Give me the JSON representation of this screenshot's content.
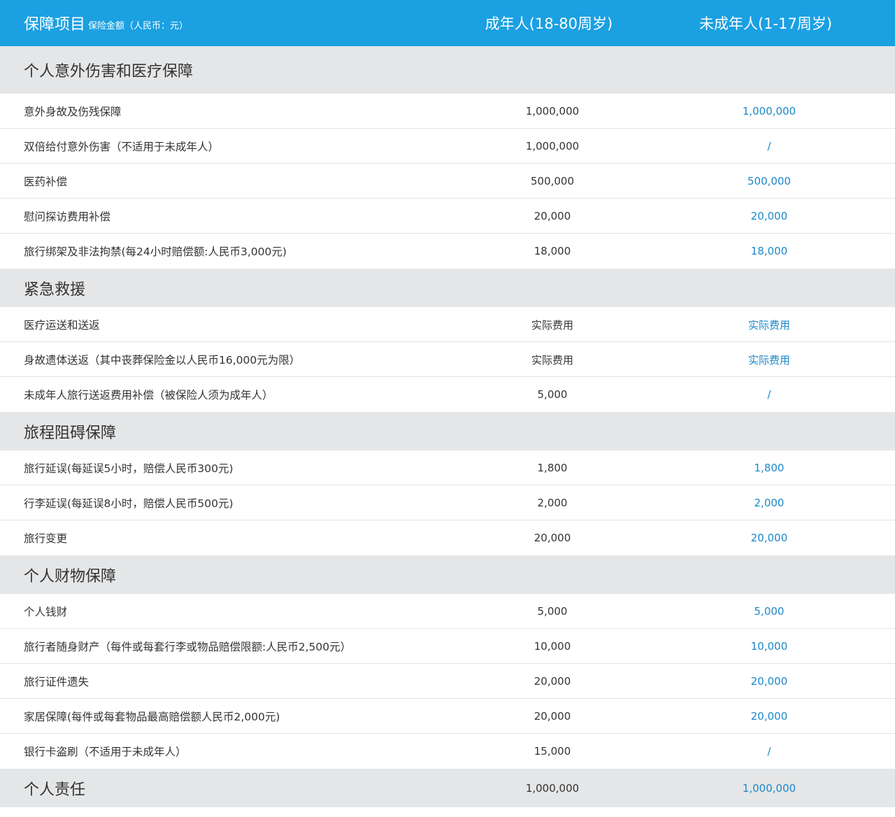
{
  "header": {
    "title": "保障项目",
    "subtitle": "保险金额（人民币：元）",
    "adult_col": "成年人(18-80周岁)",
    "minor_col": "未成年人(1-17周岁)"
  },
  "sections": [
    {
      "name": "个人意外伤害和医疗保障",
      "rows": [
        {
          "label": "意外身故及伤残保障",
          "adult": "1,000,000",
          "minor": "1,000,000"
        },
        {
          "label": "双倍给付意外伤害（不适用于未成年人）",
          "adult": "1,000,000",
          "minor": "/"
        },
        {
          "label": "医药补偿",
          "adult": "500,000",
          "minor": "500,000"
        },
        {
          "label": "慰问探访费用补偿",
          "adult": "20,000",
          "minor": "20,000"
        },
        {
          "label": "旅行绑架及非法拘禁(每24小时赔偿额:人民币3,000元)",
          "adult": "18,000",
          "minor": "18,000"
        }
      ]
    },
    {
      "name": "紧急救援",
      "rows": [
        {
          "label": "医疗运送和送返",
          "adult": "实际费用",
          "minor": "实际费用"
        },
        {
          "label": "身故遗体送返（其中丧葬保险金以人民币16,000元为限）",
          "adult": "实际费用",
          "minor": "实际费用"
        },
        {
          "label": "未成年人旅行送返费用补偿（被保险人须为成年人）",
          "adult": "5,000",
          "minor": "/"
        }
      ]
    },
    {
      "name": "旅程阻碍保障",
      "rows": [
        {
          "label": "旅行延误(每延误5小时，赔偿人民币300元)",
          "adult": "1,800",
          "minor": "1,800"
        },
        {
          "label": "行李延误(每延误8小时，赔偿人民币500元)",
          "adult": "2,000",
          "minor": "2,000"
        },
        {
          "label": "旅行变更",
          "adult": "20,000",
          "minor": "20,000"
        }
      ]
    },
    {
      "name": "个人财物保障",
      "rows": [
        {
          "label": "个人钱财",
          "adult": "5,000",
          "minor": "5,000"
        },
        {
          "label": "旅行者随身财产（每件或每套行李或物品赔偿限额:人民币2,500元）",
          "adult": "10,000",
          "minor": "10,000"
        },
        {
          "label": "旅行证件遗失",
          "adult": "20,000",
          "minor": "20,000"
        },
        {
          "label": "家居保障(每件或每套物品最高赔偿额人民币2,000元)",
          "adult": "20,000",
          "minor": "20,000"
        },
        {
          "label": "银行卡盗刷（不适用于未成年人）",
          "adult": "15,000",
          "minor": "/"
        }
      ]
    },
    {
      "name": "个人责任",
      "adult": "1,000,000",
      "minor": "1,000,000",
      "rows": []
    }
  ]
}
